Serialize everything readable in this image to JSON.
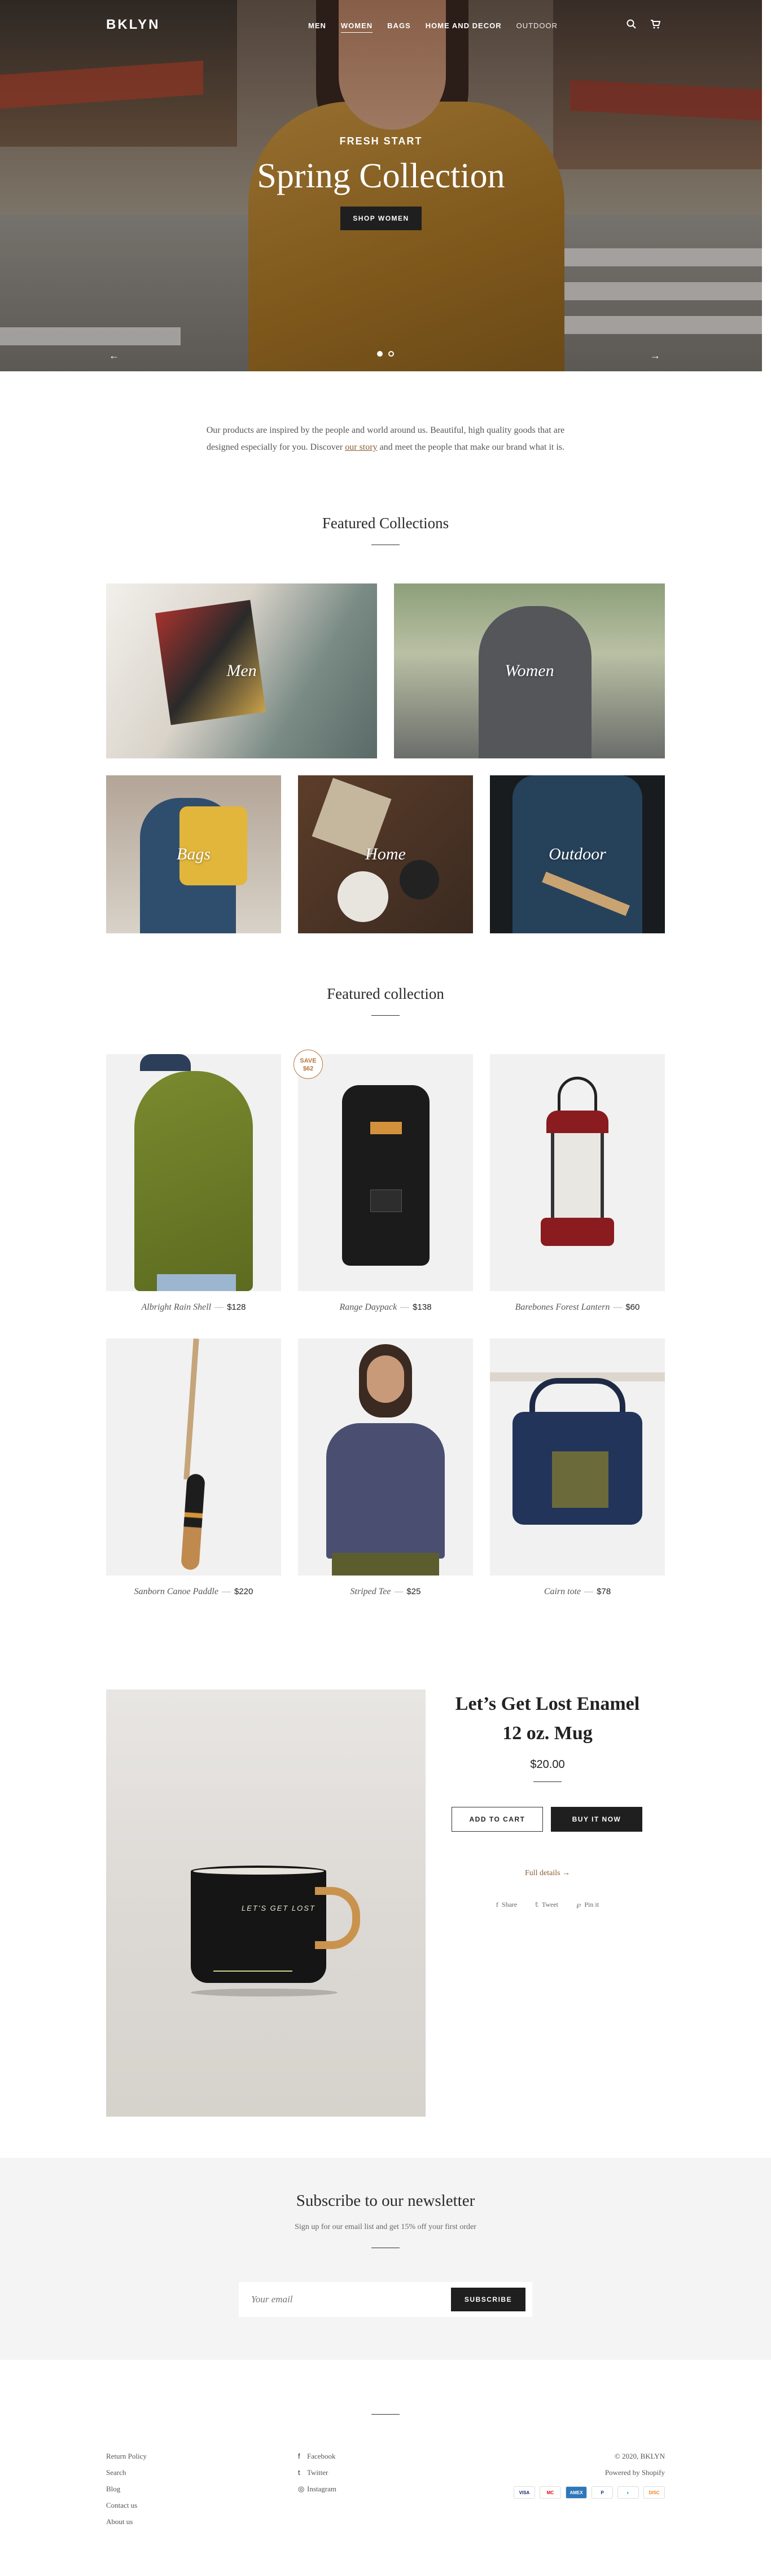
{
  "header": {
    "logo": "BKLYN",
    "nav": [
      "MEN",
      "WOMEN",
      "BAGS",
      "HOME AND DECOR",
      "OUTDOOR"
    ],
    "active_nav": "WOMEN"
  },
  "hero": {
    "kicker": "FRESH START",
    "title": "Spring Collection",
    "button": "SHOP WOMEN",
    "prev": "←",
    "next": "→",
    "slides": 2,
    "current_slide": 1
  },
  "intro": {
    "before": "Our products are inspired by the people and world around us. Beautiful, high quality goods that are designed especially for you. Discover ",
    "link": "our story",
    "after": " and meet the people that make our brand what it is."
  },
  "featured_collections": {
    "title": "Featured Collections",
    "items": [
      "Men",
      "Women",
      "Bags",
      "Home",
      "Outdoor"
    ]
  },
  "featured_collection": {
    "title": "Featured collection",
    "products": [
      {
        "name": "Albright Rain Shell",
        "price": "$128"
      },
      {
        "name": "Range Daypack",
        "price": "$138",
        "badge_line1": "SAVE",
        "badge_line2": "$62"
      },
      {
        "name": "Barebones Forest Lantern",
        "price": "$60"
      },
      {
        "name": "Sanborn Canoe Paddle",
        "price": "$220"
      },
      {
        "name": "Striped Tee",
        "price": "$25"
      },
      {
        "name": "Cairn tote",
        "price": "$78"
      }
    ]
  },
  "featured_product": {
    "title": "Let’s Get Lost Enamel 12 oz. Mug",
    "price": "$20.00",
    "add_to_cart": "ADD TO CART",
    "buy_now": "BUY IT NOW",
    "details_link": "Full details →",
    "share": {
      "share": "Share",
      "tweet": "Tweet",
      "pin": "Pin it"
    },
    "mug_text": "LET'S GET LOST"
  },
  "newsletter": {
    "title": "Subscribe to our newsletter",
    "subtitle": "Sign up for our email list and get 15% off your first order",
    "placeholder": "Your email",
    "button": "SUBSCRIBE"
  },
  "footer": {
    "links": [
      "Return Policy",
      "Search",
      "Blog",
      "Contact us",
      "About us"
    ],
    "social": [
      {
        "icon": "f",
        "label": "Facebook"
      },
      {
        "icon": "t",
        "label": "Twitter"
      },
      {
        "icon": "◎",
        "label": "Instagram"
      }
    ],
    "copyright": "© 2020, BKLYN",
    "powered": "Powered by Shopify",
    "payments": [
      "VISA",
      "MC",
      "AMEX",
      "P",
      "◐",
      "DISC"
    ]
  }
}
